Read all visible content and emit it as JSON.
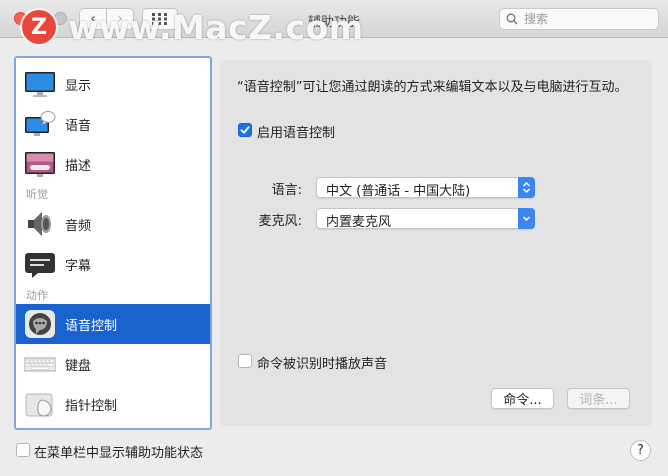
{
  "window": {
    "title": "辅助功能"
  },
  "watermark": {
    "logo_letter": "Z",
    "text": "www.MacZ.com"
  },
  "toolbar": {
    "back_glyph": "‹",
    "forward_glyph": "›"
  },
  "search": {
    "placeholder": "搜索"
  },
  "sidebar": {
    "items": [
      {
        "label": "显示",
        "icon": "display-icon"
      },
      {
        "label": "语音",
        "icon": "speech-icon"
      },
      {
        "label": "描述",
        "icon": "descriptions-icon"
      },
      {
        "label": "音频",
        "icon": "audio-icon"
      },
      {
        "label": "字幕",
        "icon": "captions-icon"
      },
      {
        "label": "语音控制",
        "icon": "voice-control-icon",
        "selected": true
      },
      {
        "label": "键盘",
        "icon": "keyboard-icon"
      },
      {
        "label": "指针控制",
        "icon": "pointer-control-icon"
      }
    ],
    "headers": {
      "hearing": "听觉",
      "motor": "动作"
    }
  },
  "main": {
    "description": "“语音控制”可让您通过朗读的方式来编辑文本以及与电脑进行互动。",
    "enable_label": "启用语音控制",
    "enable_checked": true,
    "language_label": "语言:",
    "language_value": "中文 (普通话 - 中国大陆)",
    "mic_label": "麦克风:",
    "mic_value": "内置麦克风",
    "sound_label": "命令被识别时播放声音",
    "sound_checked": false,
    "commands_button": "命令...",
    "vocabulary_button": "词条..."
  },
  "footer": {
    "menubar_label": "在菜单栏中显示辅助功能状态",
    "menubar_checked": false,
    "help_glyph": "?"
  },
  "colors": {
    "accent": "#1a63cf",
    "popup_arrow": "#3c86f1"
  }
}
